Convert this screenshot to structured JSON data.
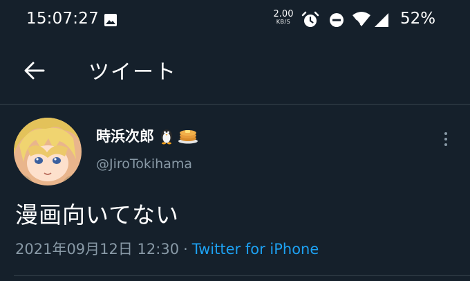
{
  "status_bar": {
    "time": "15:07:27",
    "net_speed_value": "2.00",
    "net_speed_unit": "KB/S",
    "battery": "52%",
    "icons": [
      "gallery-icon",
      "alarm-icon",
      "do-not-disturb-icon",
      "wifi-icon",
      "cellular-signal-icon"
    ]
  },
  "header": {
    "title": "ツイート",
    "back_icon": "arrow-left-icon"
  },
  "tweet": {
    "display_name": "時浜次郎",
    "name_emojis": [
      "penguin-emoji",
      "pancake-emoji"
    ],
    "handle": "@JiroTokihama",
    "text": "漫画向いてない",
    "timestamp": "2021年09月12日 12:30",
    "separator": "·",
    "source": "Twitter for iPhone",
    "more_icon": "more-vertical-icon"
  },
  "colors": {
    "background": "#15202b",
    "divider": "#38444d",
    "secondary_text": "#8899a6",
    "link": "#1da1f2"
  }
}
